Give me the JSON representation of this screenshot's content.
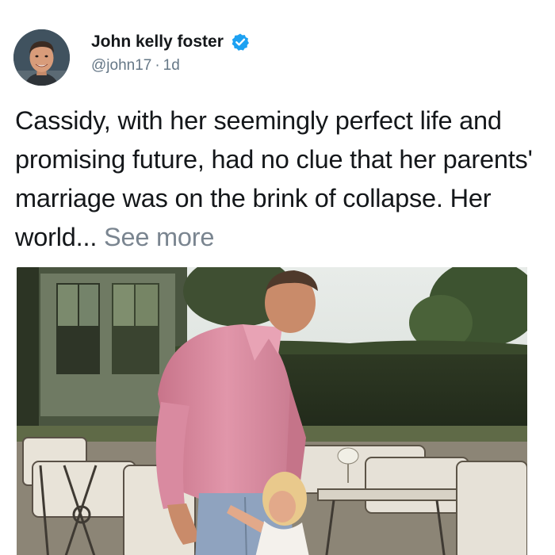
{
  "author": {
    "display_name": "John kelly foster",
    "handle": "@john17",
    "separator": "·",
    "time": "1d",
    "verified": true,
    "verified_color": "#1da1f2"
  },
  "tweet": {
    "text": "Cassidy, with her seemingly perfect life and promising future, had no clue that her parents' marriage was on the brink of collapse. Her world...",
    "see_more_label": "See more",
    "see_more_color": "#7a8590"
  },
  "icons": {
    "verified": "verified-badge-icon"
  }
}
